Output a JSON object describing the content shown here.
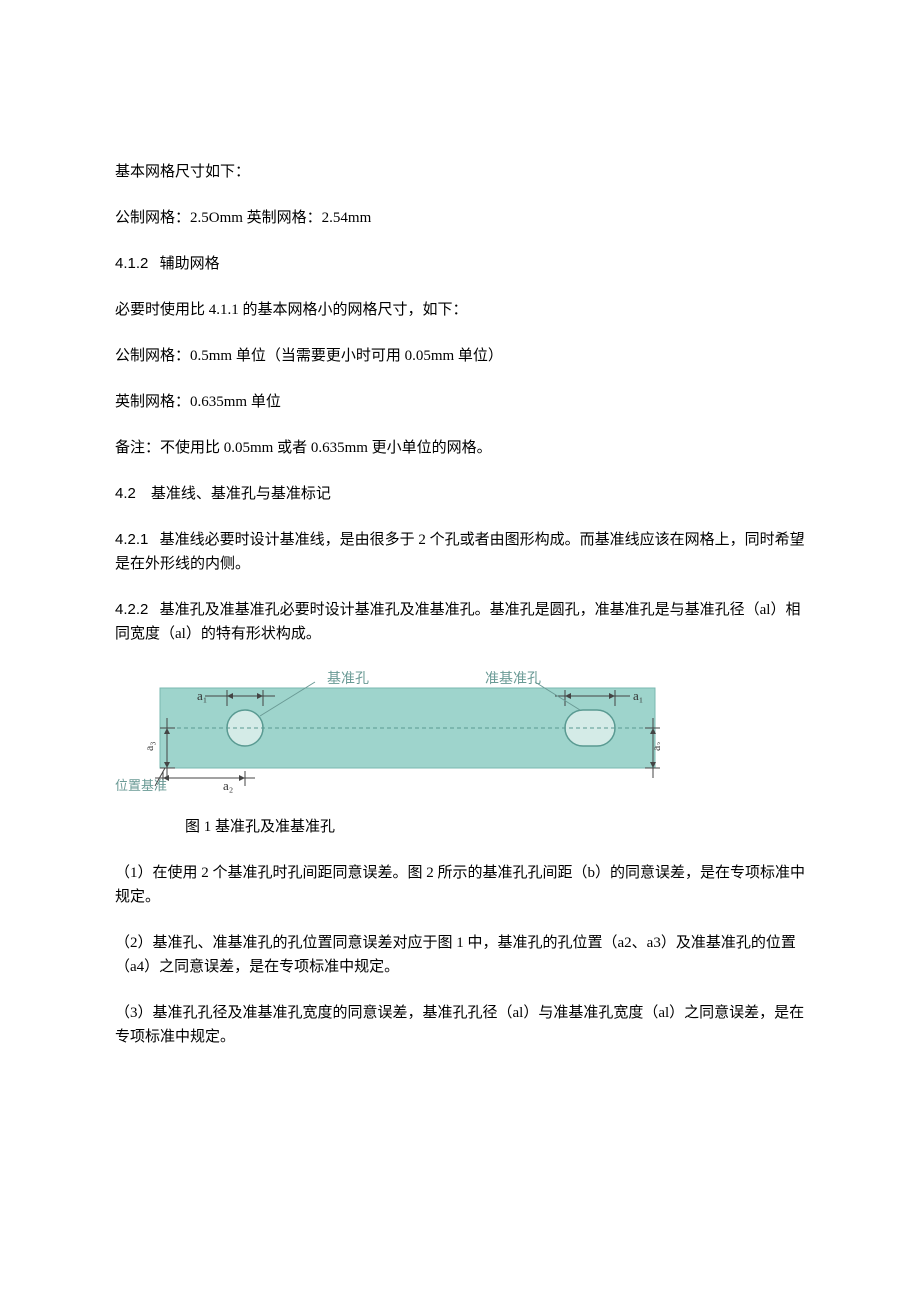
{
  "paragraphs": {
    "p1": "基本网格尺寸如下：",
    "p2": "公制网格：2.5Omm 英制网格：2.54mm",
    "p3_num": "4.1.2",
    "p3_text": "辅助网格",
    "p4": "必要时使用比 4.1.1 的基本网格小的网格尺寸，如下：",
    "p5": "公制网格：0.5mm 单位（当需要更小时可用 0.05mm 单位）",
    "p6": "英制网格：0.635mm 单位",
    "p7": "备注：不使用比 0.05mm 或者 0.635mm 更小单位的网格。",
    "p8_num": "4.2",
    "p8_text": "基准线、基准孔与基准标记",
    "p9_num": "4.2.1",
    "p9_text": "基准线必要时设计基准线，是由很多于 2 个孔或者由图形构成。而基准线应该在网格上，同时希望是在外形线的内侧。",
    "p10_num": "4.2.2",
    "p10_text": "基准孔及准基准孔必要时设计基准孔及准基准孔。基准孔是圆孔，准基准孔是与基准孔径（al）相同宽度（al）的特有形状构成。",
    "fig_caption": "图 1 基准孔及准基准孔",
    "p11": "（1）在使用 2 个基准孔时孔间距同意误差。图 2 所示的基准孔孔间距（b）的同意误差，是在专项标准中规定。",
    "p12": "（2）基准孔、准基准孔的孔位置同意误差对应于图 1 中，基准孔的孔位置（a2、a3）及准基准孔的位置（a4）之同意误差，是在专项标准中规定。",
    "p13": "（3）基准孔孔径及准基准孔宽度的同意误差，基准孔孔径（al）与准基准孔宽度（al）之同意误差，是在专项标准中规定。"
  },
  "figure": {
    "label_jizhunk": "基准孔",
    "label_zhunjizhunk": "准基准孔",
    "label_a1_left": "a₁",
    "label_a1_right": "a₁",
    "label_a2": "a₂",
    "label_a3_left": "a₃",
    "label_a3_right": "a₃",
    "label_weizhi": "位置基准"
  }
}
